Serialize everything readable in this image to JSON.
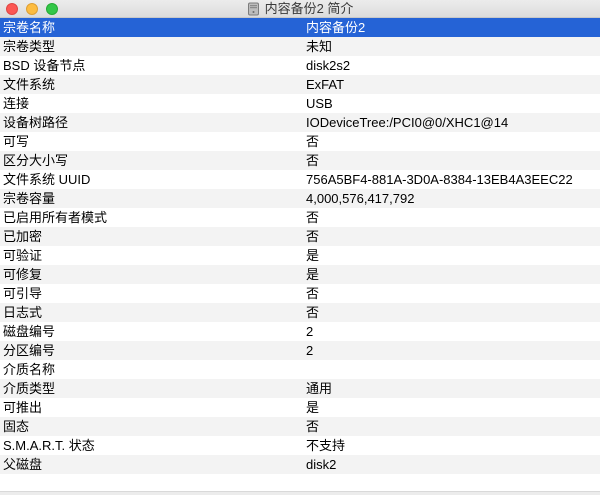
{
  "window": {
    "title": "内容备份2 简介",
    "title_icon": "external-drive-icon"
  },
  "properties": {
    "header": {
      "key": "宗卷名称",
      "value": "内容备份2"
    },
    "rows": [
      {
        "key": "宗卷类型",
        "value": "未知"
      },
      {
        "key": "BSD 设备节点",
        "value": "disk2s2"
      },
      {
        "key": "文件系统",
        "value": "ExFAT"
      },
      {
        "key": "连接",
        "value": "USB"
      },
      {
        "key": "设备树路径",
        "value": "IODeviceTree:/PCI0@0/XHC1@14"
      },
      {
        "key": "可写",
        "value": "否"
      },
      {
        "key": "区分大小写",
        "value": "否"
      },
      {
        "key": "文件系统 UUID",
        "value": "756A5BF4-881A-3D0A-8384-13EB4A3EEC22"
      },
      {
        "key": "宗卷容量",
        "value": "4,000,576,417,792"
      },
      {
        "key": "已启用所有者模式",
        "value": "否"
      },
      {
        "key": "已加密",
        "value": "否"
      },
      {
        "key": "可验证",
        "value": "是"
      },
      {
        "key": "可修复",
        "value": "是"
      },
      {
        "key": "可引导",
        "value": "否"
      },
      {
        "key": "日志式",
        "value": "否"
      },
      {
        "key": "磁盘编号",
        "value": "2"
      },
      {
        "key": "分区编号",
        "value": "2"
      },
      {
        "key": "介质名称",
        "value": ""
      },
      {
        "key": "介质类型",
        "value": "通用"
      },
      {
        "key": "可推出",
        "value": "是"
      },
      {
        "key": "固态",
        "value": "否"
      },
      {
        "key": "S.M.A.R.T. 状态",
        "value": "不支持"
      },
      {
        "key": "父磁盘",
        "value": "disk2"
      }
    ]
  },
  "colors": {
    "selection": "#2563d6",
    "stripe": "#f3f3f3",
    "close": "#fc5753",
    "minimize": "#fdbc40",
    "zoom": "#33c748"
  }
}
